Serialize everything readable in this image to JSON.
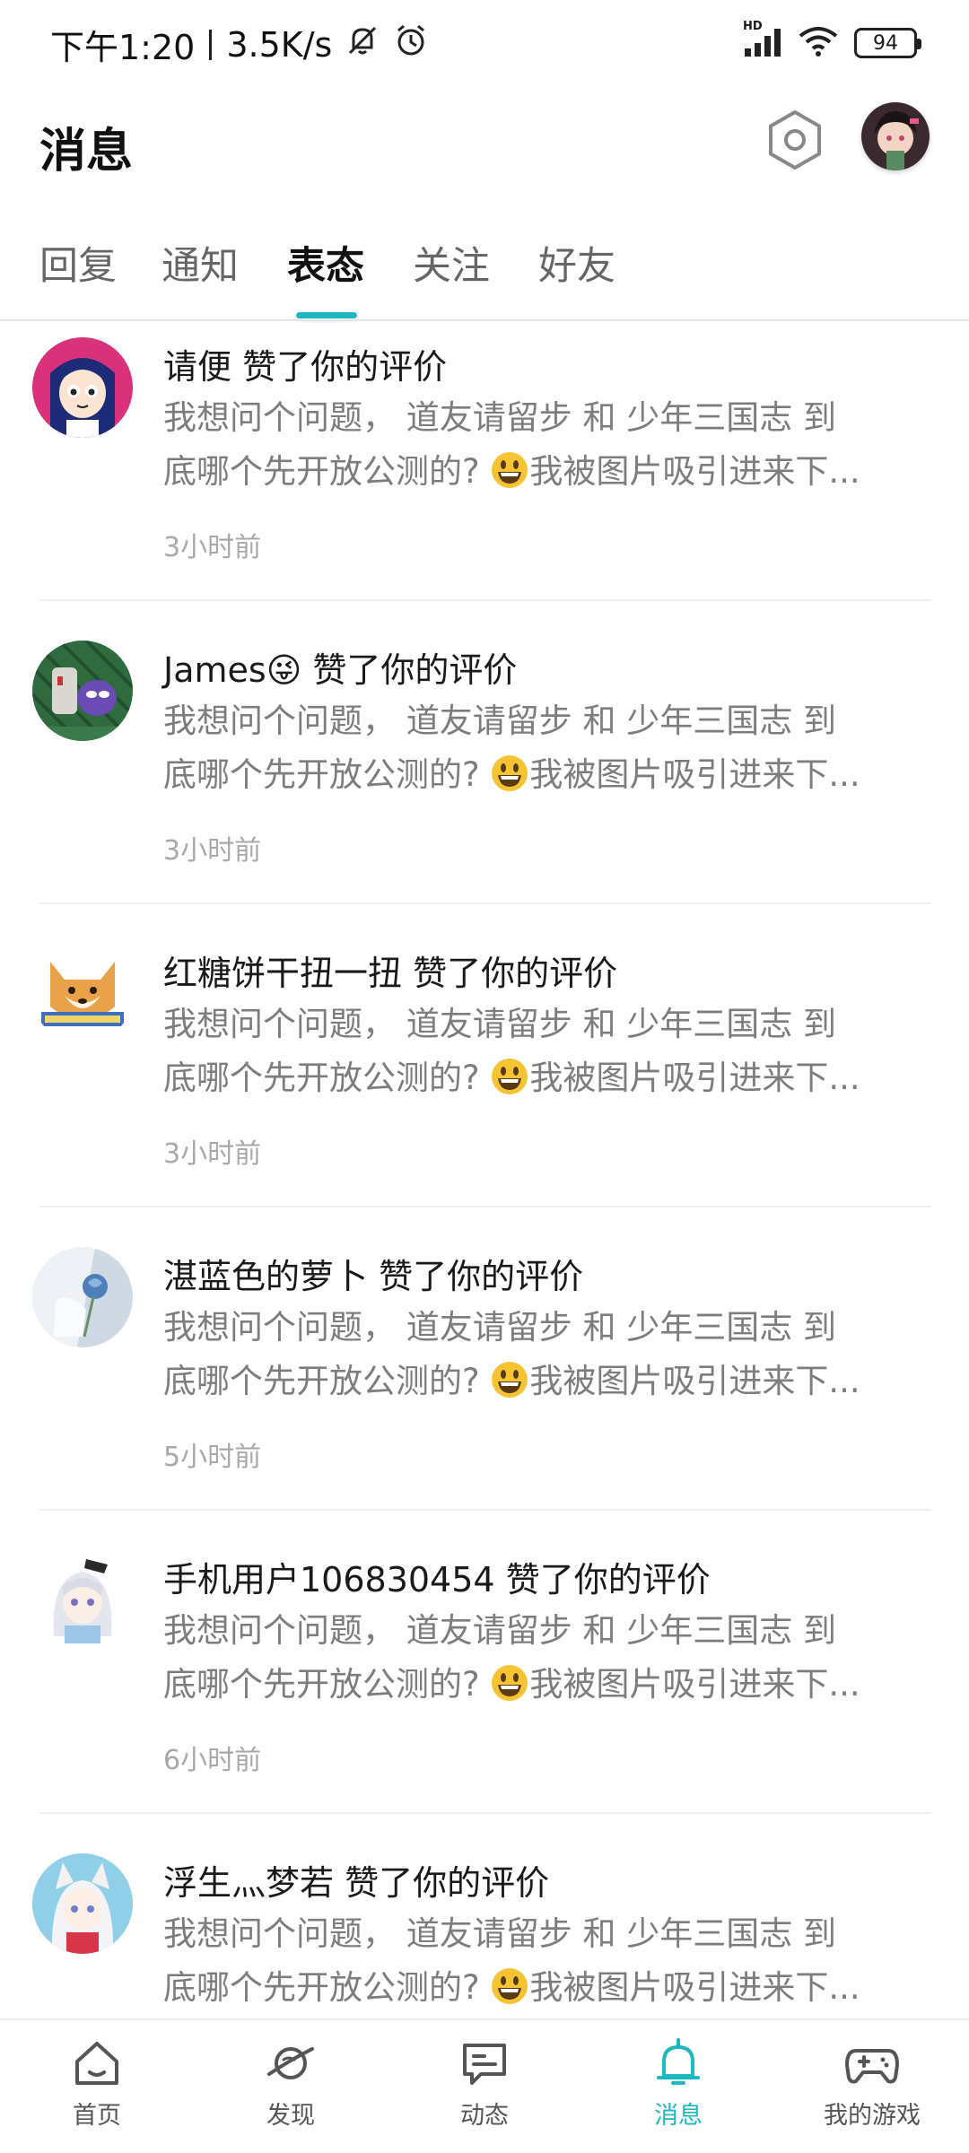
{
  "status_bar": {
    "time": "下午1:20",
    "speed": "3.5K/s",
    "hd": "HD",
    "battery": "94"
  },
  "header": {
    "title": "消息"
  },
  "colors": {
    "accent": "#1fb7bf",
    "text_primary": "#1a1a1a",
    "text_secondary": "#7d7d7d",
    "text_time": "#a9a9a9"
  },
  "tabs": [
    {
      "label": "回复",
      "active": false
    },
    {
      "label": "通知",
      "active": false
    },
    {
      "label": "表态",
      "active": true
    },
    {
      "label": "关注",
      "active": false
    },
    {
      "label": "好友",
      "active": false
    }
  ],
  "messages": [
    {
      "user": "请便",
      "user_emoji": "",
      "action": "赞了你的评价",
      "line1": "我想问个问题， 道友请留步  和  少年三国志 到",
      "line2_pre": "底哪个先开放公测的?",
      "line2_post": "我被图片吸引进来下...",
      "time": "3小时前",
      "avatar_icon": "avatar-anime-girl-icon"
    },
    {
      "user": "James",
      "user_emoji": "😜",
      "action": "赞了你的评价",
      "line1": "我想问个问题， 道友请留步  和  少年三国志 到",
      "line2_pre": "底哪个先开放公测的?",
      "line2_post": "我被图片吸引进来下...",
      "time": "3小时前",
      "avatar_icon": "avatar-game-character-icon"
    },
    {
      "user": "红糖饼干扭一扭",
      "user_emoji": "",
      "action": "赞了你的评价",
      "line1": "我想问个问题， 道友请留步  和  少年三国志 到",
      "line2_pre": "底哪个先开放公测的?",
      "line2_post": "我被图片吸引进来下...",
      "time": "3小时前",
      "avatar_icon": "avatar-shiba-dog-icon"
    },
    {
      "user": "湛蓝色的萝卜",
      "user_emoji": "",
      "action": "赞了你的评价",
      "line1": "我想问个问题， 道友请留步  和  少年三国志 到",
      "line2_pre": "底哪个先开放公测的?",
      "line2_post": "我被图片吸引进来下...",
      "time": "5小时前",
      "avatar_icon": "avatar-blue-rose-icon"
    },
    {
      "user": "手机用户106830454",
      "user_emoji": "",
      "action": "赞了你的评价",
      "line1": "我想问个问题， 道友请留步  和  少年三国志 到",
      "line2_pre": "底哪个先开放公测的?",
      "line2_post": "我被图片吸引进来下...",
      "time": "6小时前",
      "avatar_icon": "avatar-white-hair-girl-icon"
    },
    {
      "user": "浮生灬梦若",
      "user_emoji": "",
      "action": "赞了你的评价",
      "line1": "我想问个问题， 道友请留步  和  少年三国志 到",
      "line2_pre": "底哪个先开放公测的?",
      "line2_post": "我被图片吸引进来下...",
      "time": "",
      "avatar_icon": "avatar-fox-girl-icon"
    }
  ],
  "bottom_nav": [
    {
      "label": "首页",
      "icon": "home-icon",
      "active": false
    },
    {
      "label": "发现",
      "icon": "planet-icon",
      "active": false
    },
    {
      "label": "动态",
      "icon": "chat-icon",
      "active": false
    },
    {
      "label": "消息",
      "icon": "bell-icon",
      "active": true
    },
    {
      "label": "我的游戏",
      "icon": "gamepad-icon",
      "active": false
    }
  ]
}
